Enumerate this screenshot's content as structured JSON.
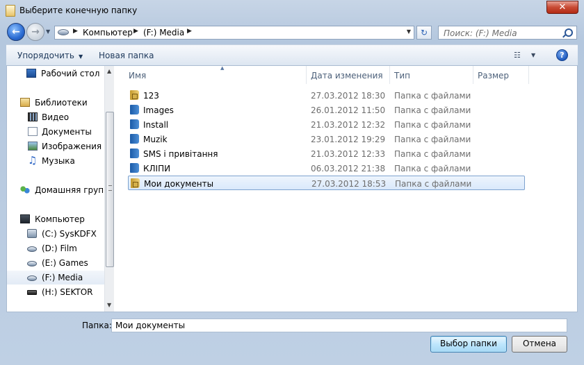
{
  "window": {
    "title": "Выберите конечную папку",
    "close_label": "✕"
  },
  "nav": {
    "breadcrumb": [
      "Компьютер",
      "(F:) Media"
    ],
    "search_placeholder": "Поиск: (F:) Media"
  },
  "toolbar": {
    "organize": "Упорядочить",
    "new_folder": "Новая папка",
    "views_icon": "☷",
    "help": "?"
  },
  "sidebar": {
    "items": [
      {
        "label": "Рабочий стол",
        "icon": "desktop-icon"
      },
      {
        "label": "Библиотеки",
        "icon": "libraries-icon"
      },
      {
        "label": "Видео",
        "icon": "video-icon"
      },
      {
        "label": "Документы",
        "icon": "documents-icon"
      },
      {
        "label": "Изображения",
        "icon": "images-icon"
      },
      {
        "label": "Музыка",
        "icon": "music-icon"
      },
      {
        "label": "Домашняя группа",
        "icon": "homegroup-icon"
      },
      {
        "label": "Компьютер",
        "icon": "computer-icon"
      },
      {
        "label": "(C:) SysKDFX",
        "icon": "system-drive-icon"
      },
      {
        "label": "(D:) Film",
        "icon": "drive-icon"
      },
      {
        "label": "(E:) Games",
        "icon": "drive-icon"
      },
      {
        "label": "(F:) Media",
        "icon": "drive-icon",
        "selected": true
      },
      {
        "label": "(H:) SEKTOR",
        "icon": "usb-drive-icon"
      }
    ]
  },
  "filelist": {
    "columns": [
      "Имя",
      "Дата изменения",
      "Тип",
      "Размер"
    ],
    "rows": [
      {
        "name": "123",
        "date": "27.03.2012 18:30",
        "type": "Папка с файлами",
        "locked": true
      },
      {
        "name": "Images",
        "date": "26.01.2012 11:50",
        "type": "Папка с файлами"
      },
      {
        "name": "Install",
        "date": "21.03.2012 12:32",
        "type": "Папка с файлами"
      },
      {
        "name": "Muzik",
        "date": "23.01.2012 19:29",
        "type": "Папка с файлами"
      },
      {
        "name": "SMS і привітання",
        "date": "21.03.2012 12:33",
        "type": "Папка с файлами"
      },
      {
        "name": "КЛІПИ",
        "date": "06.03.2012 21:38",
        "type": "Папка с файлами"
      },
      {
        "name": "Мои документы",
        "date": "27.03.2012 18:53",
        "type": "Папка с файлами",
        "locked": true,
        "selected": true
      }
    ]
  },
  "footer": {
    "folder_label": "Папка:",
    "folder_value": "Мои документы",
    "select_button": "Выбор папки",
    "cancel_button": "Отмена"
  },
  "colors": {
    "accent": "#3c7fb1",
    "selection": "#d9e8fb",
    "chrome": "#b4c7de"
  }
}
